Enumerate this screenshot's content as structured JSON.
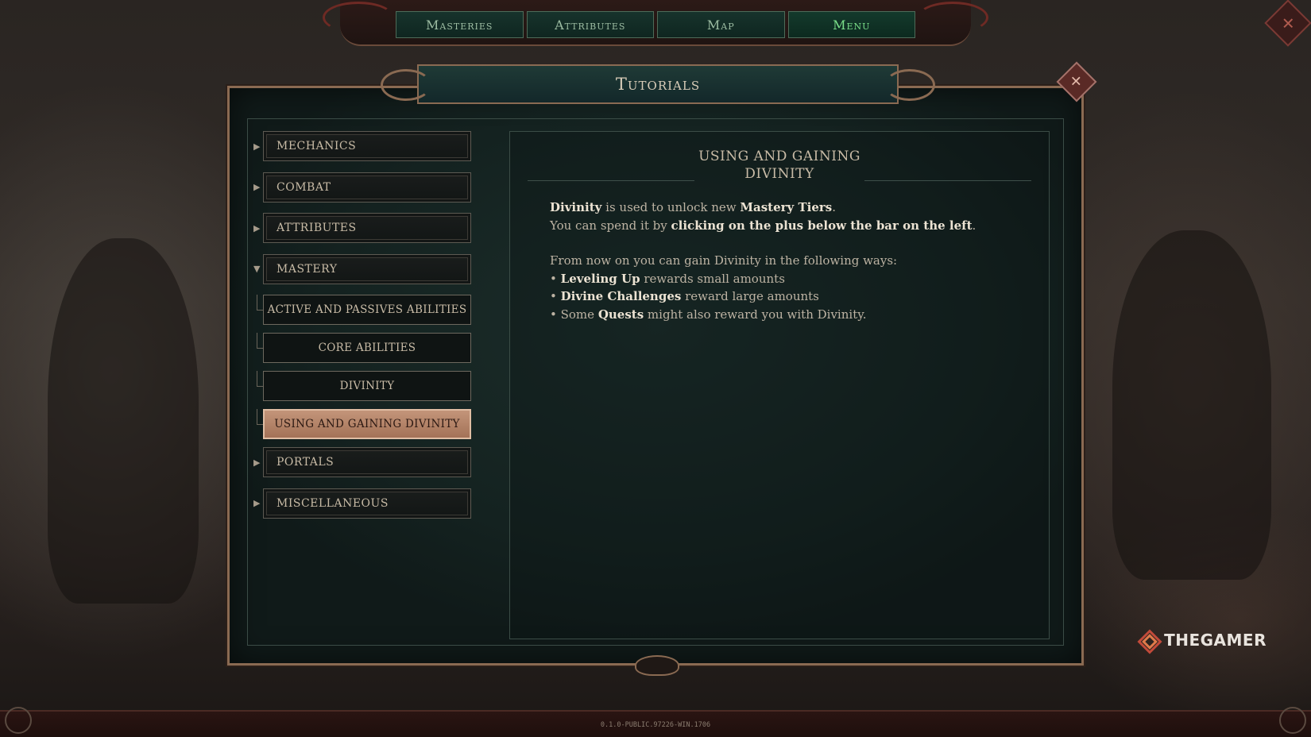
{
  "top_nav": {
    "tabs": [
      {
        "label": "Masteries",
        "active": false
      },
      {
        "label": "Attributes",
        "active": false
      },
      {
        "label": "Map",
        "active": false
      },
      {
        "label": "Menu",
        "active": true
      }
    ]
  },
  "panel": {
    "title": "Tutorials",
    "close_icon": "close-x-icon"
  },
  "sidebar": {
    "categories": [
      {
        "label": "MECHANICS",
        "expanded": false
      },
      {
        "label": "COMBAT",
        "expanded": false
      },
      {
        "label": "ATTRIBUTES",
        "expanded": false
      },
      {
        "label": "MASTERY",
        "expanded": true
      },
      {
        "label": "PORTALS",
        "expanded": false
      },
      {
        "label": "MISCELLANEOUS",
        "expanded": false
      }
    ],
    "mastery_items": [
      {
        "label": "ACTIVE AND PASSIVES ABILITIES",
        "selected": false
      },
      {
        "label": "CORE ABILITIES",
        "selected": false
      },
      {
        "label": "DIVINITY",
        "selected": false
      },
      {
        "label": "USING AND GAINING DIVINITY",
        "selected": true
      }
    ]
  },
  "content": {
    "title_line1": "USING AND GAINING",
    "title_line2": "DIVINITY",
    "p1_b1": "Divinity",
    "p1_t1": " is used to unlock new ",
    "p1_b2": "Mastery Tiers",
    "p1_t2": ".",
    "p2_t1": "You can spend it by ",
    "p2_b1": "clicking on the plus below the bar on the left",
    "p2_t2": ".",
    "p3": "From now on you can gain Divinity in the following ways:",
    "bullet": "•",
    "b1_bold": "Leveling Up",
    "b1_text": " rewards small amounts",
    "b2_bold": "Divine Challenges",
    "b2_text": " reward large amounts",
    "b3_pre": " Some ",
    "b3_bold": "Quests",
    "b3_text": " might also reward you with Divinity."
  },
  "footer": {
    "version": "0.1.0-PUBLIC.97226-WIN.1706"
  },
  "watermark": {
    "text": "THEGAMER"
  },
  "colors": {
    "active_tab": "#7be08a",
    "selected_item_bg": "#c3957a",
    "panel_border": "#8a6a52"
  }
}
